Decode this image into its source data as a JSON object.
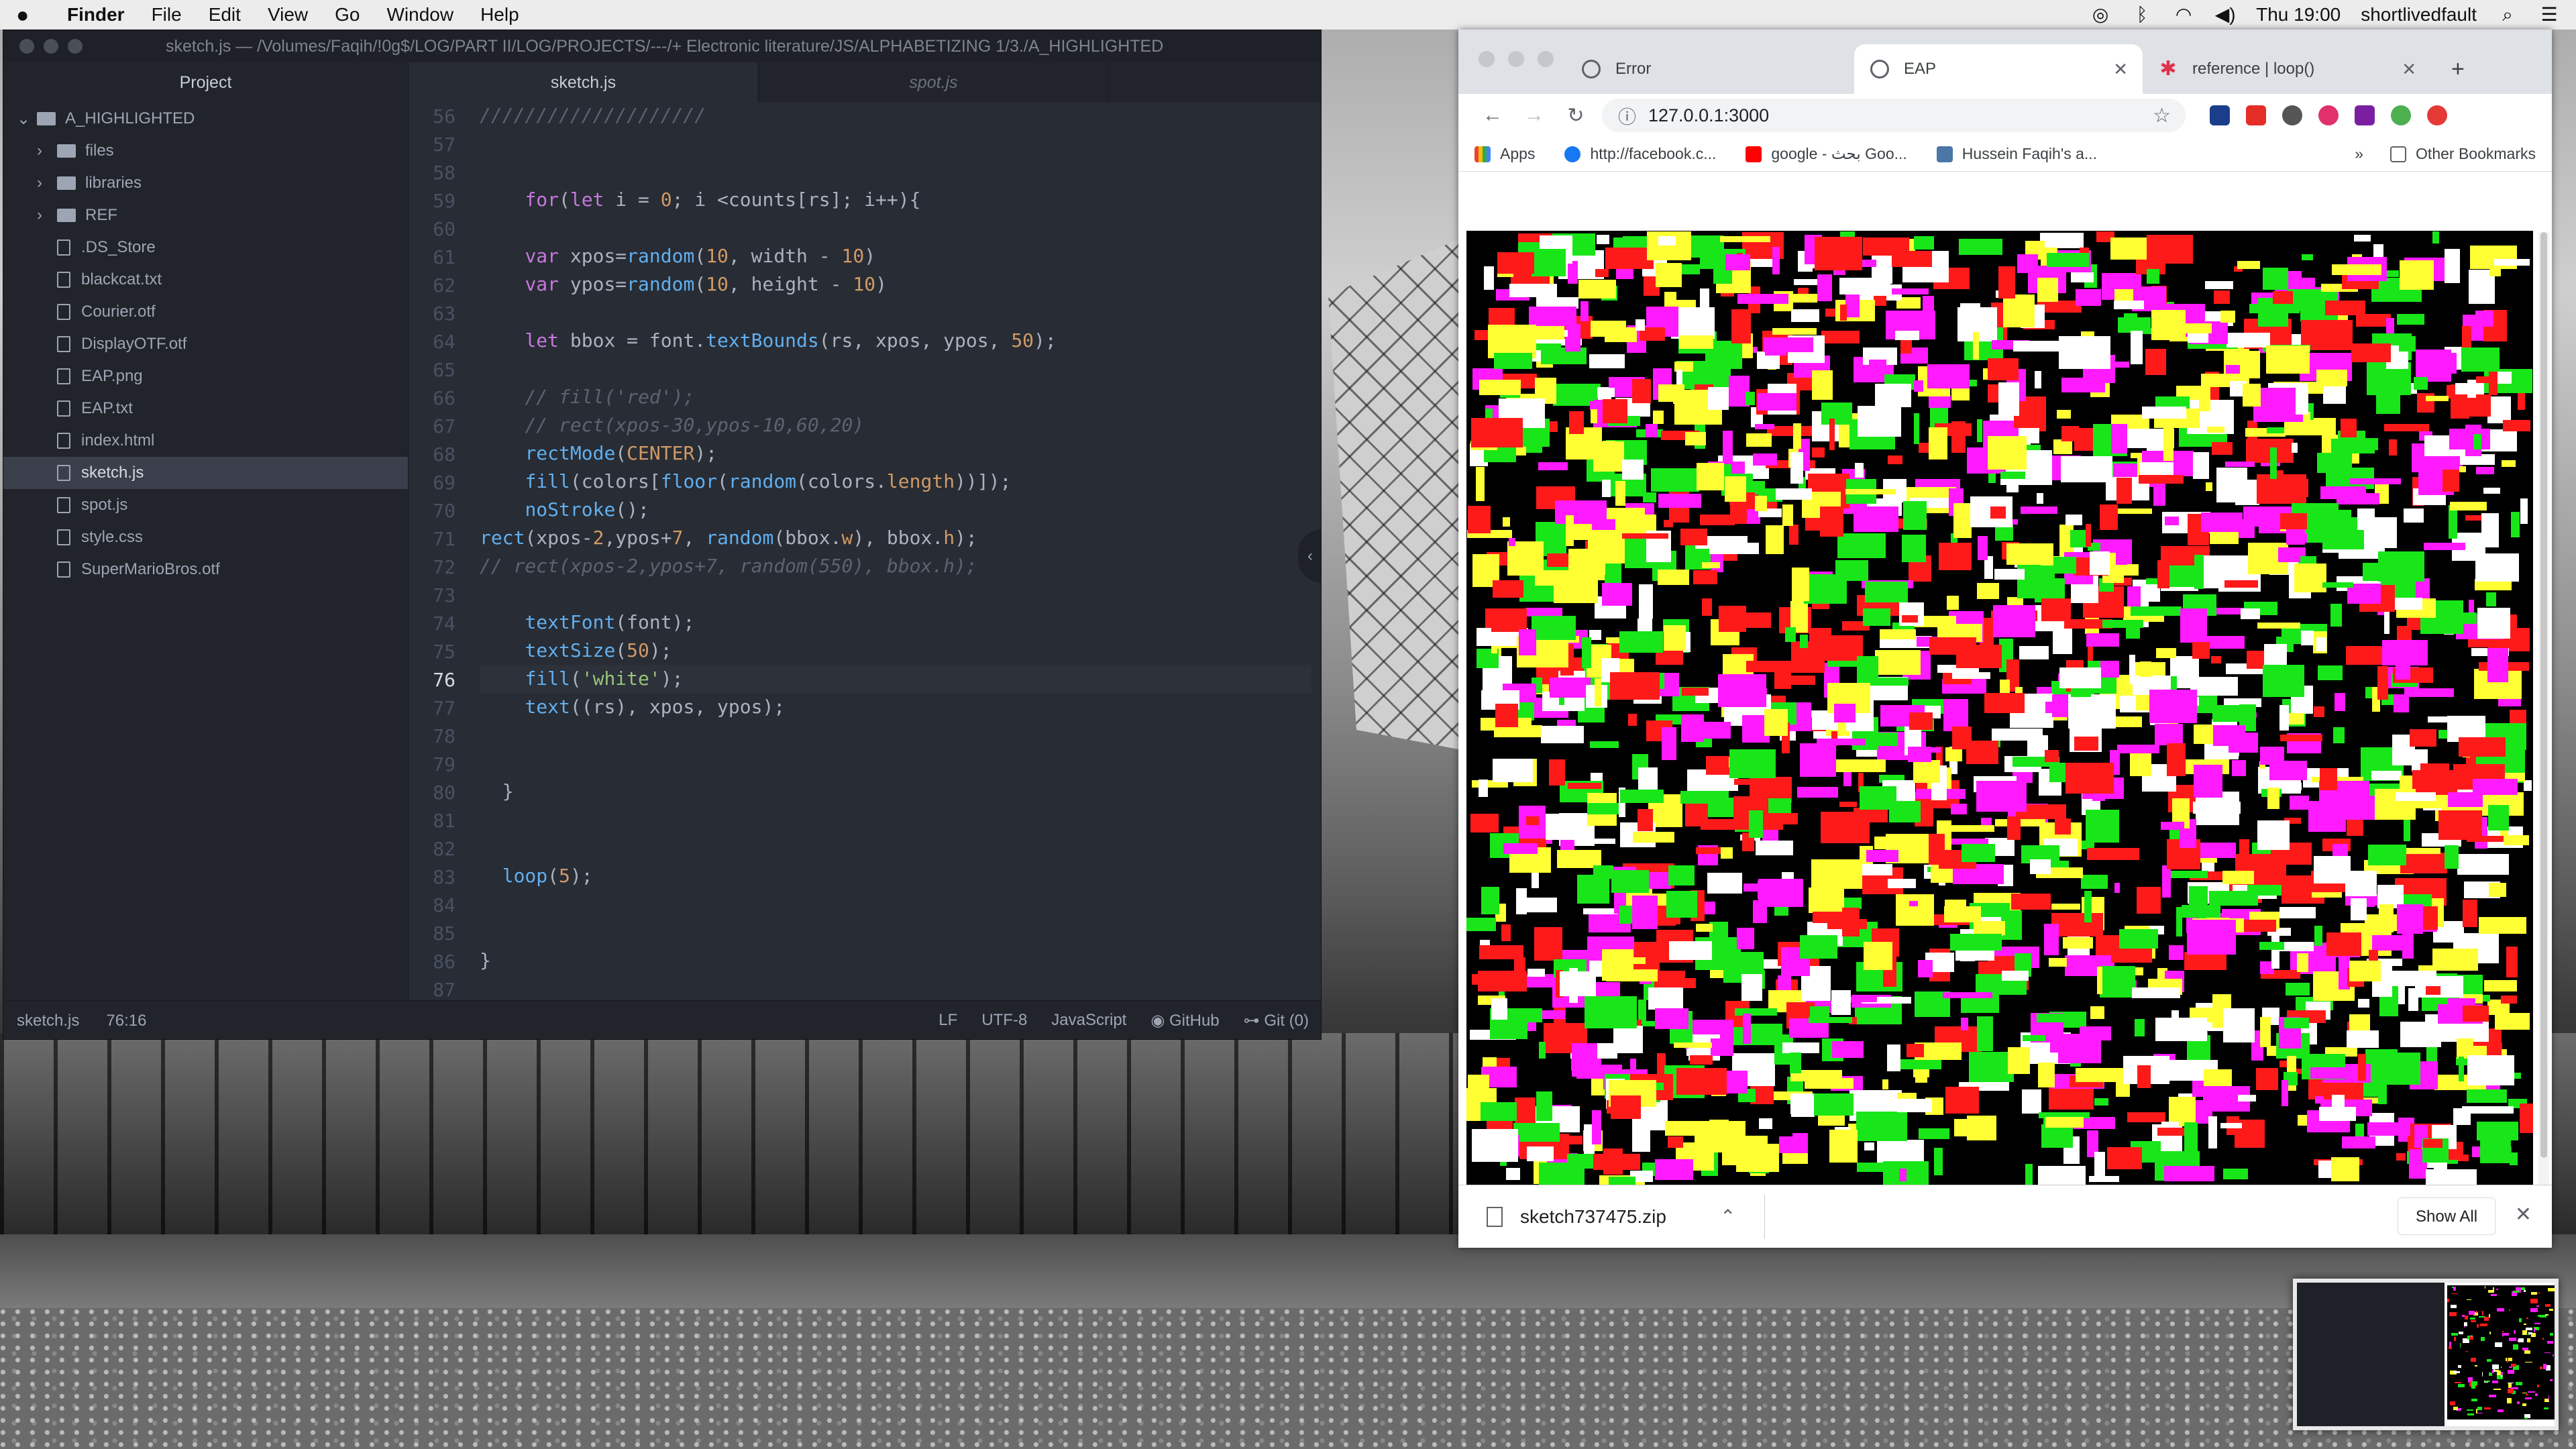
{
  "menubar": {
    "app": "Finder",
    "menus": [
      "File",
      "Edit",
      "View",
      "Go",
      "Window",
      "Help"
    ],
    "time": "Thu 19:00",
    "user": "shortlivedfault"
  },
  "editor": {
    "title": "sketch.js — /Volumes/Faqih/!0g$/LOG/PART II/LOG/PROJECTS/---/+ Electronic literature/JS/ALPHABETIZING 1/3./A_HIGHLIGHTED",
    "project_tab": "Project",
    "tabs": [
      "sketch.js",
      "spot.js"
    ],
    "tree_root": "A_HIGHLIGHTED",
    "folders": [
      "files",
      "libraries",
      "REF"
    ],
    "files": [
      ".DS_Store",
      "blackcat.txt",
      "Courier.otf",
      "DisplayOTF.otf",
      "EAP.png",
      "EAP.txt",
      "index.html",
      "sketch.js",
      "spot.js",
      "style.css",
      "SuperMarioBros.otf"
    ],
    "selected_file": "sketch.js",
    "line_numbers": [
      "56",
      "57",
      "58",
      "59",
      "60",
      "61",
      "62",
      "63",
      "64",
      "65",
      "66",
      "67",
      "68",
      "69",
      "70",
      "71",
      "72",
      "73",
      "74",
      "75",
      "76",
      "77",
      "78",
      "79",
      "80",
      "81",
      "82",
      "83",
      "84",
      "85",
      "86",
      "87"
    ],
    "current_line": "76",
    "status": {
      "file": "sketch.js",
      "cursor": "76:16",
      "eol": "LF",
      "encoding": "UTF-8",
      "grammar": "JavaScript",
      "github": "GitHub",
      "git": "Git (0)"
    }
  },
  "browser": {
    "tabs": [
      {
        "title": "Error"
      },
      {
        "title": "EAP"
      },
      {
        "title": "reference | loop()"
      }
    ],
    "url": "127.0.0.1:3000",
    "bookmarks": [
      "Apps",
      "http://facebook.c...",
      "google - بحث Goo...",
      "Hussein Faqih's a..."
    ],
    "bookmarks_more": "»",
    "other_bookmarks": "Other Bookmarks",
    "download": {
      "filename": "sketch737475.zip",
      "show_all": "Show All"
    }
  },
  "colors": {
    "palette": [
      "#ff1a1a",
      "#ff1aff",
      "#19e619",
      "#ffff33",
      "#ffffff"
    ],
    "editor_bg": "#282c34",
    "keyword": "#c678dd",
    "function": "#61afef",
    "number": "#d19a66",
    "string": "#98c379",
    "comment": "#5c6370"
  }
}
